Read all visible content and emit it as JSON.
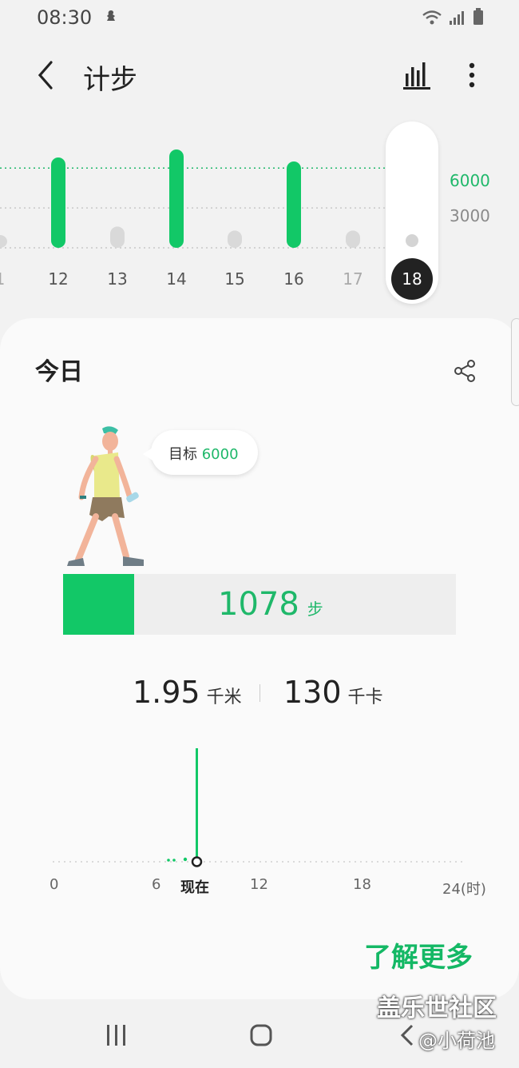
{
  "status_bar": {
    "time": "08:30"
  },
  "app_bar": {
    "title": "计步"
  },
  "week_chart": {
    "goal_label": "6000",
    "mid_label": "3000",
    "days": [
      {
        "label": "1",
        "steps": 800,
        "met_goal": false
      },
      {
        "label": "12",
        "steps": 6800,
        "met_goal": true
      },
      {
        "label": "13",
        "steps": 1600,
        "met_goal": false
      },
      {
        "label": "14",
        "steps": 7400,
        "met_goal": true
      },
      {
        "label": "15",
        "steps": 1300,
        "met_goal": false
      },
      {
        "label": "16",
        "steps": 6500,
        "met_goal": true
      },
      {
        "label": "17",
        "steps": 1300,
        "met_goal": false
      },
      {
        "label": "18",
        "steps": 1078,
        "met_goal": false,
        "selected": true
      }
    ]
  },
  "today": {
    "title": "今日",
    "goal_prefix": "目标",
    "goal_value": "6000",
    "steps": "1078",
    "steps_unit": "步",
    "progress_fraction": 0.18,
    "distance": "1.95",
    "distance_unit": "千米",
    "calories": "130",
    "calories_unit": "千卡",
    "axis_ticks": [
      "0",
      "6",
      "现在",
      "12",
      "18",
      "24(时)"
    ],
    "learn_more": "了解更多"
  },
  "watermark": {
    "line1": "盖乐世社区",
    "line2": "@小荷池"
  },
  "colors": {
    "accent": "#12c867",
    "text_green": "#1fb86a",
    "bar_grey": "#d9d9d9"
  }
}
